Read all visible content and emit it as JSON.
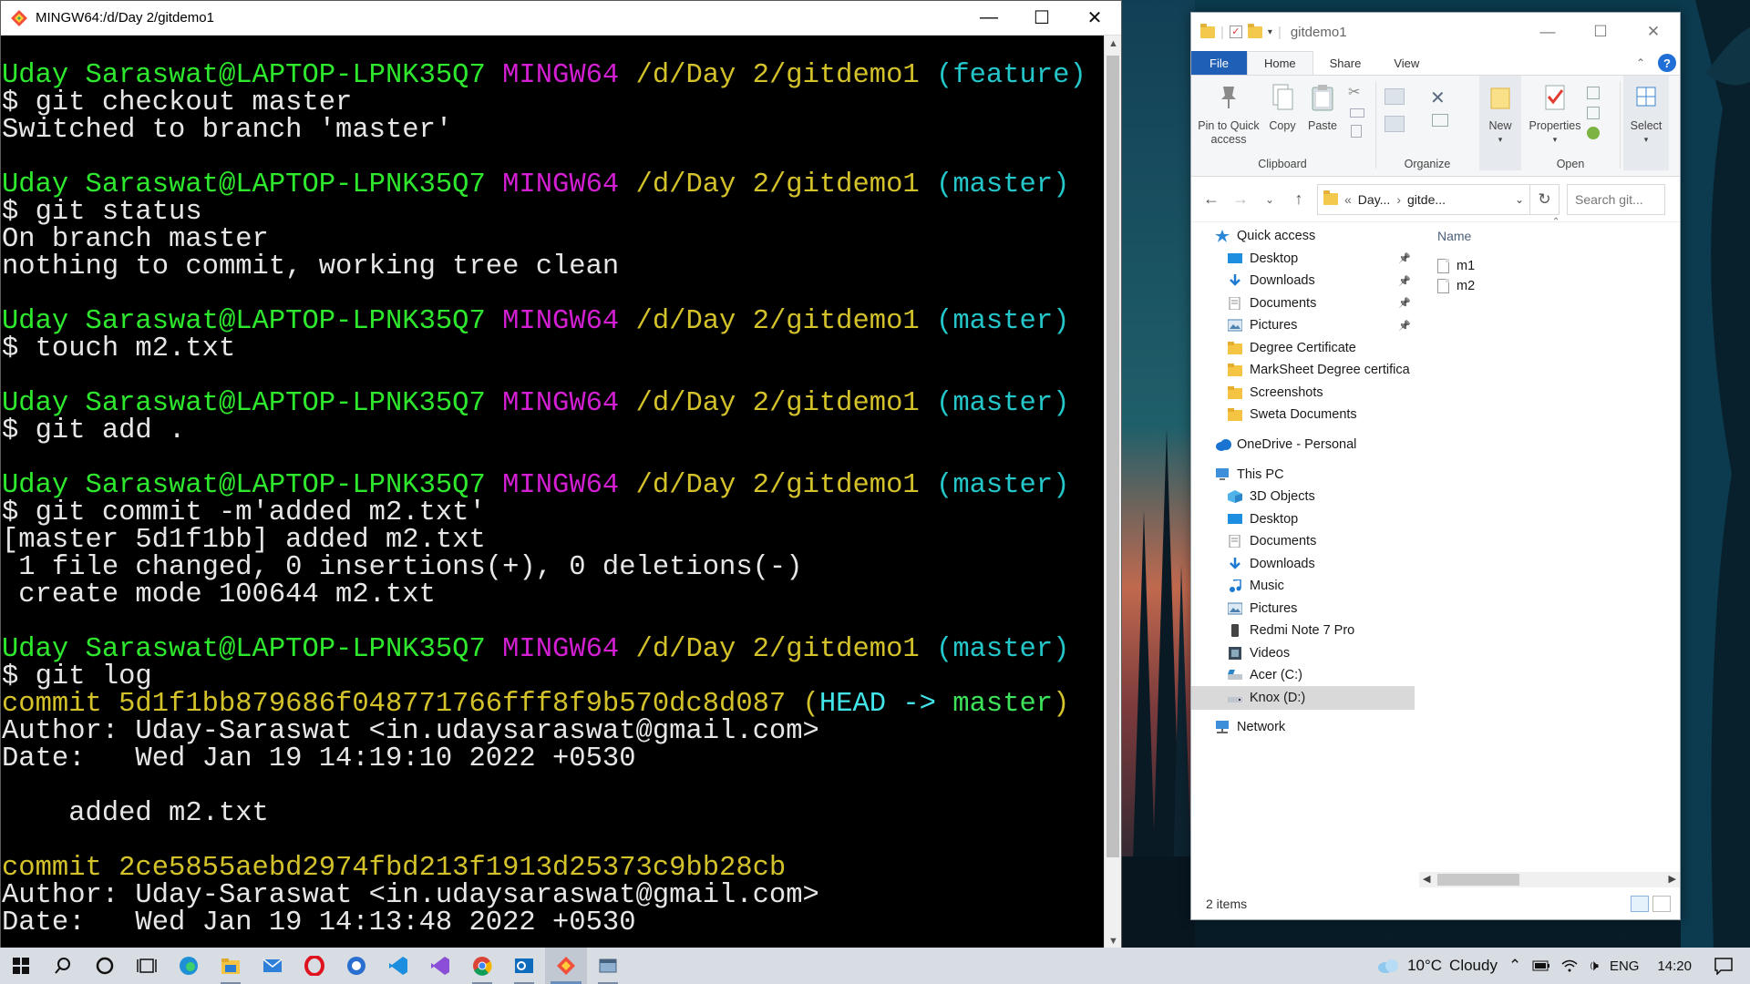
{
  "terminal": {
    "title": "MINGW64:/d/Day 2/gitdemo1",
    "lines": [
      {
        "segs": [
          {
            "t": "Uday Saraswat@LAPTOP-LPNK35Q7",
            "c": "green"
          },
          {
            "t": " ",
            "c": "white"
          },
          {
            "t": "MINGW64",
            "c": "mag"
          },
          {
            "t": " ",
            "c": "white"
          },
          {
            "t": "/d/Day 2/gitdemo1",
            "c": "yel"
          },
          {
            "t": " ",
            "c": "white"
          },
          {
            "t": "(feature)",
            "c": "cyan"
          }
        ]
      },
      {
        "segs": [
          {
            "t": "$ git checkout master",
            "c": "white"
          }
        ]
      },
      {
        "segs": [
          {
            "t": "Switched to branch 'master'",
            "c": "white"
          }
        ]
      },
      {
        "segs": [
          {
            "t": "",
            "c": "white"
          }
        ]
      },
      {
        "segs": [
          {
            "t": "Uday Saraswat@LAPTOP-LPNK35Q7",
            "c": "green"
          },
          {
            "t": " ",
            "c": "white"
          },
          {
            "t": "MINGW64",
            "c": "mag"
          },
          {
            "t": " ",
            "c": "white"
          },
          {
            "t": "/d/Day 2/gitdemo1",
            "c": "yel"
          },
          {
            "t": " ",
            "c": "white"
          },
          {
            "t": "(master)",
            "c": "cyan"
          }
        ]
      },
      {
        "segs": [
          {
            "t": "$ git status",
            "c": "white"
          }
        ]
      },
      {
        "segs": [
          {
            "t": "On branch master",
            "c": "white"
          }
        ]
      },
      {
        "segs": [
          {
            "t": "nothing to commit, working tree clean",
            "c": "white"
          }
        ]
      },
      {
        "segs": [
          {
            "t": "",
            "c": "white"
          }
        ]
      },
      {
        "segs": [
          {
            "t": "Uday Saraswat@LAPTOP-LPNK35Q7",
            "c": "green"
          },
          {
            "t": " ",
            "c": "white"
          },
          {
            "t": "MINGW64",
            "c": "mag"
          },
          {
            "t": " ",
            "c": "white"
          },
          {
            "t": "/d/Day 2/gitdemo1",
            "c": "yel"
          },
          {
            "t": " ",
            "c": "white"
          },
          {
            "t": "(master)",
            "c": "cyan"
          }
        ]
      },
      {
        "segs": [
          {
            "t": "$ touch m2.txt",
            "c": "white"
          }
        ]
      },
      {
        "segs": [
          {
            "t": "",
            "c": "white"
          }
        ]
      },
      {
        "segs": [
          {
            "t": "Uday Saraswat@LAPTOP-LPNK35Q7",
            "c": "green"
          },
          {
            "t": " ",
            "c": "white"
          },
          {
            "t": "MINGW64",
            "c": "mag"
          },
          {
            "t": " ",
            "c": "white"
          },
          {
            "t": "/d/Day 2/gitdemo1",
            "c": "yel"
          },
          {
            "t": " ",
            "c": "white"
          },
          {
            "t": "(master)",
            "c": "cyan"
          }
        ]
      },
      {
        "segs": [
          {
            "t": "$ git add .",
            "c": "white"
          }
        ]
      },
      {
        "segs": [
          {
            "t": "",
            "c": "white"
          }
        ]
      },
      {
        "segs": [
          {
            "t": "Uday Saraswat@LAPTOP-LPNK35Q7",
            "c": "green"
          },
          {
            "t": " ",
            "c": "white"
          },
          {
            "t": "MINGW64",
            "c": "mag"
          },
          {
            "t": " ",
            "c": "white"
          },
          {
            "t": "/d/Day 2/gitdemo1",
            "c": "yel"
          },
          {
            "t": " ",
            "c": "white"
          },
          {
            "t": "(master)",
            "c": "cyan"
          }
        ]
      },
      {
        "segs": [
          {
            "t": "$ git commit -m'added m2.txt'",
            "c": "white"
          }
        ]
      },
      {
        "segs": [
          {
            "t": "[master 5d1f1bb] added m2.txt",
            "c": "white"
          }
        ]
      },
      {
        "segs": [
          {
            "t": " 1 file changed, 0 insertions(+), 0 deletions(-)",
            "c": "white"
          }
        ]
      },
      {
        "segs": [
          {
            "t": " create mode 100644 m2.txt",
            "c": "white"
          }
        ]
      },
      {
        "segs": [
          {
            "t": "",
            "c": "white"
          }
        ]
      },
      {
        "segs": [
          {
            "t": "Uday Saraswat@LAPTOP-LPNK35Q7",
            "c": "green"
          },
          {
            "t": " ",
            "c": "white"
          },
          {
            "t": "MINGW64",
            "c": "mag"
          },
          {
            "t": " ",
            "c": "white"
          },
          {
            "t": "/d/Day 2/gitdemo1",
            "c": "yel"
          },
          {
            "t": " ",
            "c": "white"
          },
          {
            "t": "(master)",
            "c": "cyan"
          }
        ]
      },
      {
        "segs": [
          {
            "t": "$ git log",
            "c": "white"
          }
        ]
      },
      {
        "segs": [
          {
            "t": "commit 5d1f1bb879686f048771766fff8f9b570dc8d087 (",
            "c": "yel"
          },
          {
            "t": "HEAD -> ",
            "c": "headcyan"
          },
          {
            "t": "master",
            "c": "headgreen"
          },
          {
            "t": ")",
            "c": "yel"
          }
        ]
      },
      {
        "segs": [
          {
            "t": "Author: Uday-Saraswat <in.udaysaraswat@gmail.com>",
            "c": "white"
          }
        ]
      },
      {
        "segs": [
          {
            "t": "Date:   Wed Jan 19 14:19:10 2022 +0530",
            "c": "white"
          }
        ]
      },
      {
        "segs": [
          {
            "t": "",
            "c": "white"
          }
        ]
      },
      {
        "segs": [
          {
            "t": "    added m2.txt",
            "c": "white"
          }
        ]
      },
      {
        "segs": [
          {
            "t": "",
            "c": "white"
          }
        ]
      },
      {
        "segs": [
          {
            "t": "commit 2ce5855aebd2974fbd213f1913d25373c9bb28cb",
            "c": "yel"
          }
        ]
      },
      {
        "segs": [
          {
            "t": "Author: Uday-Saraswat <in.udaysaraswat@gmail.com>",
            "c": "white"
          }
        ]
      },
      {
        "segs": [
          {
            "t": "Date:   Wed Jan 19 14:13:48 2022 +0530",
            "c": "white"
          }
        ]
      }
    ]
  },
  "explorer": {
    "title": "gitdemo1",
    "tabs": {
      "file": "File",
      "home": "Home",
      "share": "Share",
      "view": "View"
    },
    "ribbon": {
      "pin": "Pin to Quick access",
      "copy": "Copy",
      "paste": "Paste",
      "new": "New",
      "properties": "Properties",
      "select": "Select",
      "group_clipboard": "Clipboard",
      "group_organize": "Organize",
      "group_open": "Open"
    },
    "address": {
      "part1": "Day...",
      "part2": "gitde..."
    },
    "search_placeholder": "Search git...",
    "nav": {
      "quick_access": "Quick access",
      "qa_items": [
        "Desktop",
        "Downloads",
        "Documents",
        "Pictures",
        "Degree Certificate",
        "MarkSheet Degree certifica",
        "Screenshots",
        "Sweta Documents"
      ],
      "onedrive": "OneDrive - Personal",
      "this_pc": "This PC",
      "pc_items": [
        "3D Objects",
        "Desktop",
        "Documents",
        "Downloads",
        "Music",
        "Pictures",
        "Redmi Note 7 Pro",
        "Videos",
        "Acer (C:)",
        "Knox (D:)"
      ],
      "network": "Network"
    },
    "column_name": "Name",
    "files": [
      "m1",
      "m2"
    ],
    "status": "2 items"
  },
  "taskbar": {
    "weather_temp": "10°C",
    "weather_text": "Cloudy",
    "lang": "ENG",
    "time": "14:20"
  },
  "colors": {
    "prompt_green": "#2ee82e",
    "prompt_magenta": "#d11fd1",
    "path_yellow": "#d4c22a",
    "branch_cyan": "#24c6c9",
    "file_tab_blue": "#1f5fb5"
  }
}
